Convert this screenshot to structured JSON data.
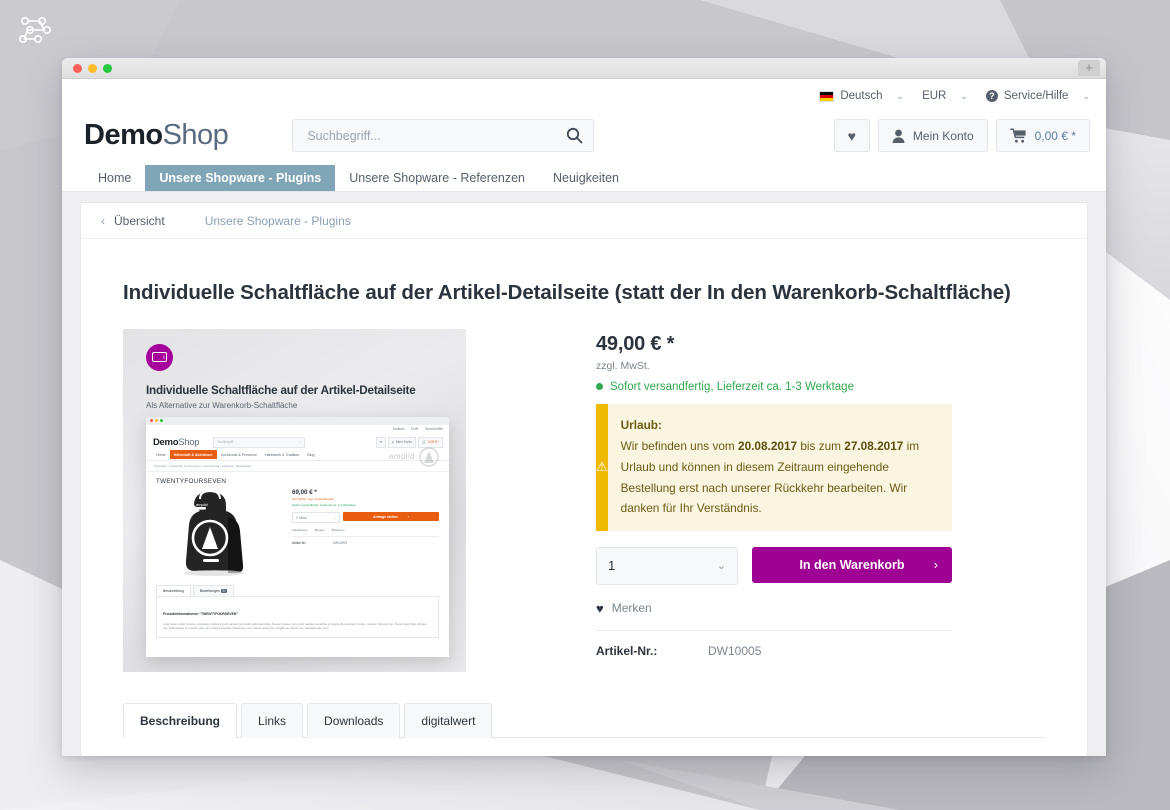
{
  "desktop": {
    "brandmark_icon": "node-graph-icon",
    "next_arrow": "›"
  },
  "browser": {
    "traffic_lights": [
      "close",
      "minimize",
      "maximize"
    ],
    "new_tab_label": "+"
  },
  "topbar": {
    "language": {
      "label": "Deutsch",
      "flag": "german-flag",
      "caret": "⌄"
    },
    "currency": {
      "label": "EUR",
      "caret": "⌄"
    },
    "service": {
      "label": "Service/Hilfe",
      "icon": "question-circle-icon",
      "glyph": "?",
      "caret": "⌄"
    }
  },
  "header": {
    "logo_bold": "Demo",
    "logo_light": "Shop",
    "search": {
      "placeholder": "Suchbegriff...",
      "value": "",
      "icon": "search-icon"
    },
    "wishlist": {
      "icon": "heart-icon",
      "glyph": "♥"
    },
    "account": {
      "label": "Mein Konto",
      "icon": "user-icon"
    },
    "cart": {
      "label": "0,00 € *",
      "icon": "cart-icon"
    }
  },
  "nav": {
    "items": [
      {
        "label": "Home",
        "active": false
      },
      {
        "label": "Unsere Shopware - Plugins",
        "active": true
      },
      {
        "label": "Unsere Shopware - Referenzen",
        "active": false
      },
      {
        "label": "Neuigkeiten",
        "active": false
      }
    ]
  },
  "breadcrumb": {
    "back_label": "Übersicht",
    "back_icon": "chevron-left-icon",
    "back_glyph": "‹",
    "category": "Unsere Shopware - Plugins"
  },
  "product": {
    "title": "Individuelle Schaltfläche auf der Artikel-Detailseite (statt der In den Warenkorb-Schaltfläche)",
    "price": "49,00 € *",
    "vat_note": "zzgl. MwSt.",
    "stock": "Sofort versandfertig, Lieferzeit ca. 1-3 Werktage",
    "notice": {
      "icon": "warning-triangle-icon",
      "glyph": "⚠",
      "title": "Urlaub:",
      "text_1": "Wir befinden uns vom ",
      "date_from": "20.08.2017",
      "text_2": " bis zum ",
      "date_to": "27.08.2017",
      "text_3": " im Urlaub und können in diesem Zeitraum eingehende Bestellung erst nach unserer Rückkehr bearbeiten. Wir danken für Ihr Verständnis."
    },
    "quantity": {
      "value": "1",
      "caret": "⌄"
    },
    "add_to_cart": {
      "label": "In den Warenkorb",
      "arrow": "›"
    },
    "remember": {
      "label": "Merken",
      "icon": "heart-icon",
      "glyph": "♥"
    },
    "sku_label": "Artikel-Nr.:",
    "sku_value": "DW10005"
  },
  "product_image": {
    "badge_icon": "screen-arrow-icon",
    "badge_glyph": "›",
    "headline": "Individuelle Schaltfläche auf der Artikel-Detailseite",
    "subline": "Als Alternative zur Warenkorb-Schaltfläche",
    "inner_shop": {
      "logo_bold": "Demo",
      "logo_light": "Shop",
      "search_placeholder": "Suchbegriff",
      "search_icon": "search-icon",
      "topbar": [
        "Deutsch",
        "EUR",
        "Service/Hilfe"
      ],
      "actions": [
        "Mein Konto",
        "0,00 € *"
      ],
      "nav": [
        {
          "label": "Home",
          "active": false
        },
        {
          "label": "Höhenluft & Abenteuer",
          "active": true
        },
        {
          "label": "Kochkunst & Provence",
          "active": false
        },
        {
          "label": "Handwerk & Tradition",
          "active": false
        },
        {
          "label": "Blog",
          "active": false
        }
      ],
      "crumbs": "Übersicht   ›   Höhenluft & Abenteuer   ›   Ausrüstung   ›   Zubehör   ›   Rucksäcke",
      "crumb_last": "Rucksäcke",
      "product_name": "TWENTYFOURSEVEN",
      "brand": "amplid",
      "price": "69,00 € *",
      "vat_note": "inkl. MwSt. zzgl. Versandkosten",
      "stock": "Sofort versandfertig, Lieferzeit ca. 1-3 Werktage",
      "qty": "1 Stück",
      "cta": "Anfrage stellen",
      "cta_arrow": "›",
      "links": [
        "Vergleichen",
        "Merken",
        "Bewerten"
      ],
      "sku_label": "Artikel-Nr.:",
      "sku_value": "SW10003",
      "tabs": [
        {
          "label": "Beschreibung",
          "active": true
        },
        {
          "label": "Bewertungen",
          "active": false,
          "badge": "0"
        }
      ],
      "desc_title": "Produktinformationen \"TWENTYFOURSEVEN\"",
      "desc_body": "Lorem ipsum dolor sit amet, consectetur adipiscing elit, aenean commodo ligula eget dolor. Aenean massa. Cum sociis natoque penatibus et magnis dis parturient montes, nascetur ridiculus mus. Donec quam felis, ultricies nec, pellentesque eu, pretium quis, sem. Nulla consequat massa quis enim. Donec pede justo, fringilla vel, aliquet nec, vulputate eget, arcu."
    }
  },
  "tabs": {
    "items": [
      {
        "label": "Beschreibung",
        "active": true
      },
      {
        "label": "Links",
        "active": false
      },
      {
        "label": "Downloads",
        "active": false
      },
      {
        "label": "digitalwert",
        "active": false
      }
    ]
  },
  "colors": {
    "accent_magenta": "#9d0093",
    "nav_active": "#7fa5b7",
    "notice_bar": "#eeb900",
    "notice_bg": "#faf5e1",
    "stock_green": "#2fa84f",
    "inner_orange": "#e85d12"
  }
}
